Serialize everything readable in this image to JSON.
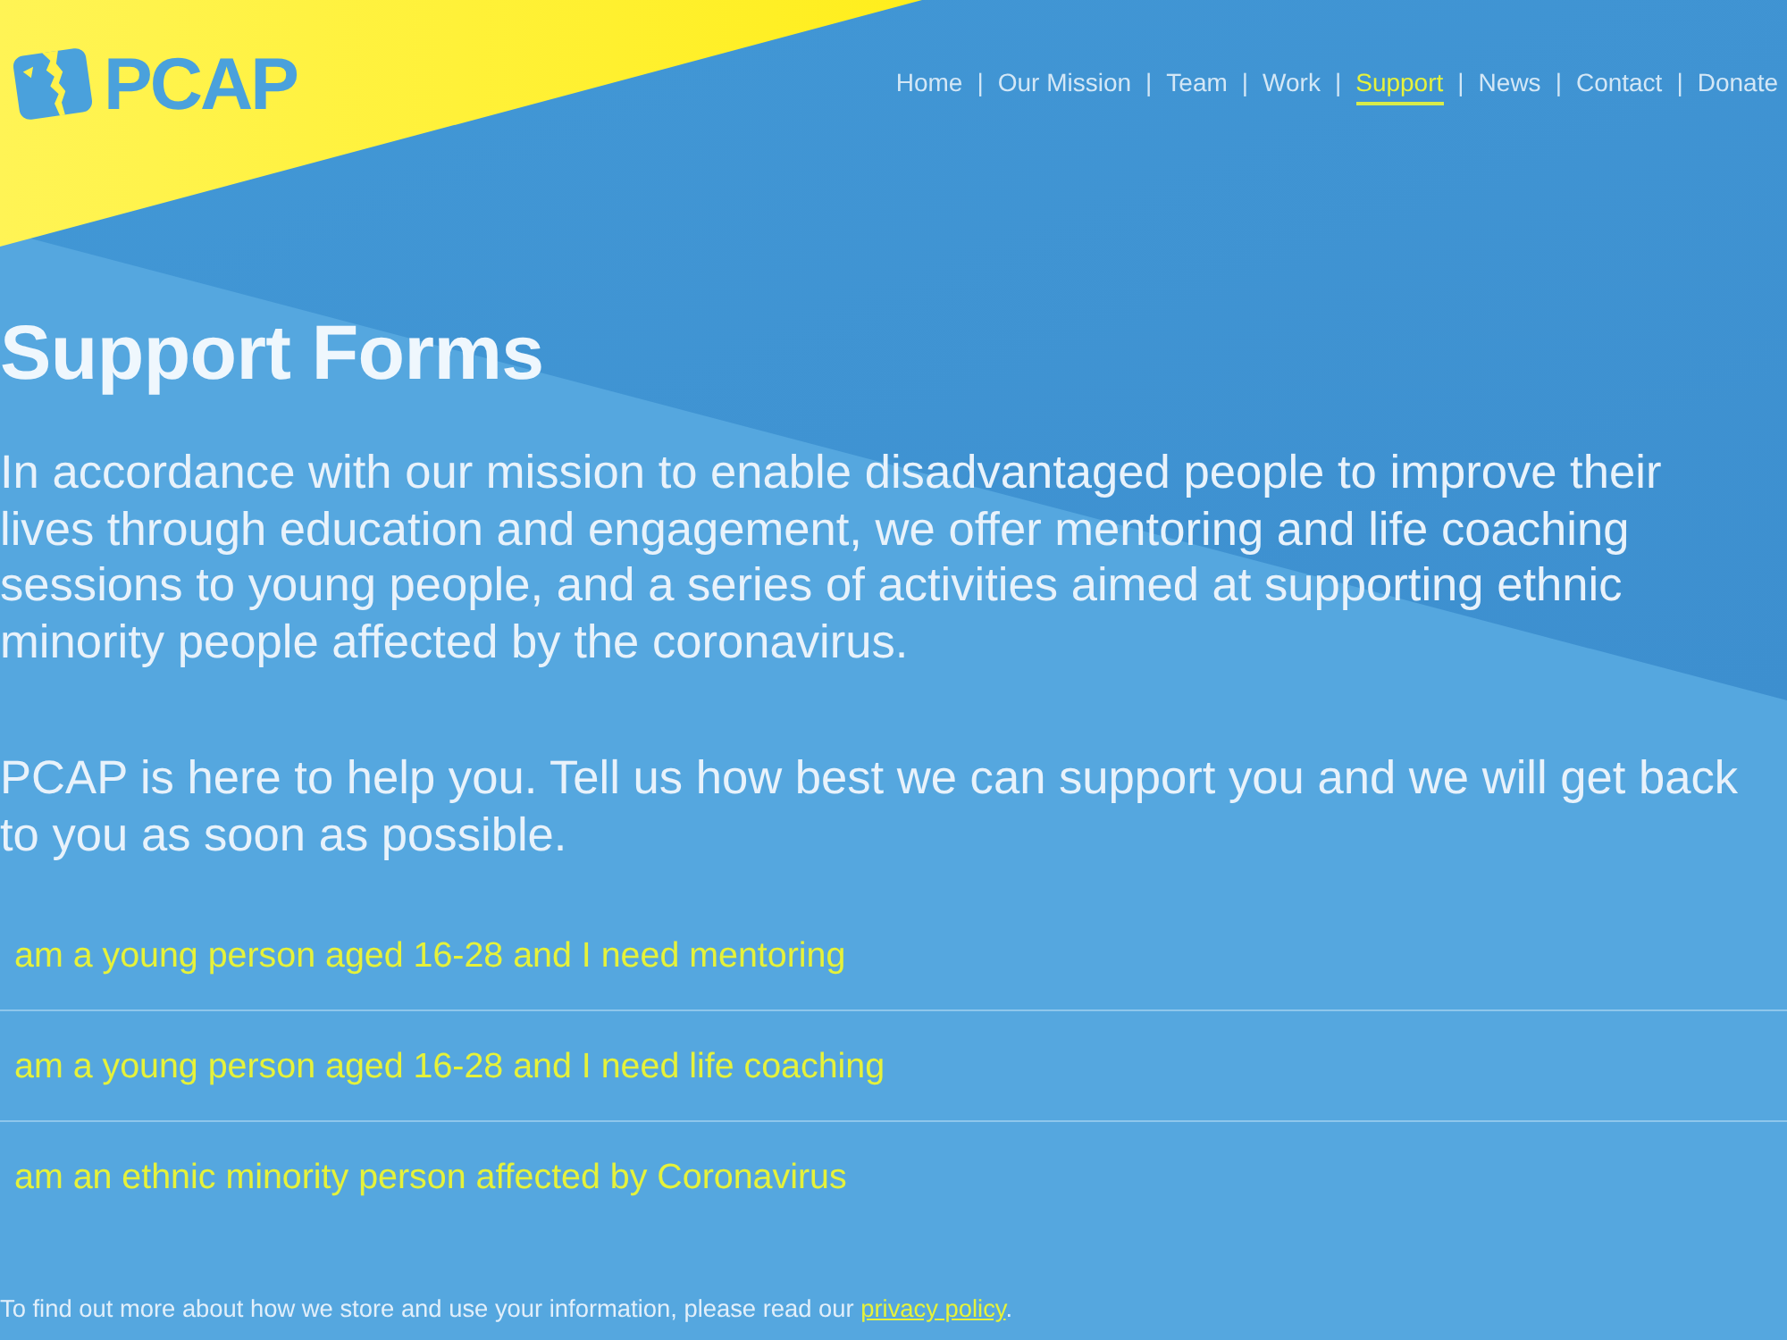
{
  "logo": {
    "text": "PCAP"
  },
  "nav": [
    {
      "label": "Home",
      "selected": false,
      "separator": "|"
    },
    {
      "label": "Our Mission",
      "selected": false,
      "separator": "|"
    },
    {
      "label": "Team",
      "selected": false,
      "separator": "|"
    },
    {
      "label": "Work",
      "selected": false,
      "separator": "|"
    },
    {
      "label": "Support",
      "selected": true,
      "separator": "|"
    },
    {
      "label": "News",
      "selected": false,
      "separator": "|"
    },
    {
      "label": "Contact",
      "selected": false,
      "separator": "|"
    },
    {
      "label": "Donate",
      "selected": false
    }
  ],
  "heading": "Support Forms",
  "paragraphs": [
    "In accordance with our mission to enable disadvantaged people to improve their lives through education and engagement, we offer mentoring and life coaching sessions to young people, and a series of activities aimed at supporting ethnic minority people affected by the coronavirus.",
    "PCAP is here to help you. Tell us how best we can support you and we will get back to you as soon as possible."
  ],
  "form_links": [
    {
      "label": "am a young person aged 16-28 and I need mentoring"
    },
    {
      "label": "am a young person aged 16-28 and I need life coaching"
    },
    {
      "label": "am an ethnic minority person affected by Coronavirus"
    }
  ],
  "footer": {
    "text": "To find out more about how we store and use your information, please read our ",
    "link": "privacy policy",
    "after": "."
  }
}
